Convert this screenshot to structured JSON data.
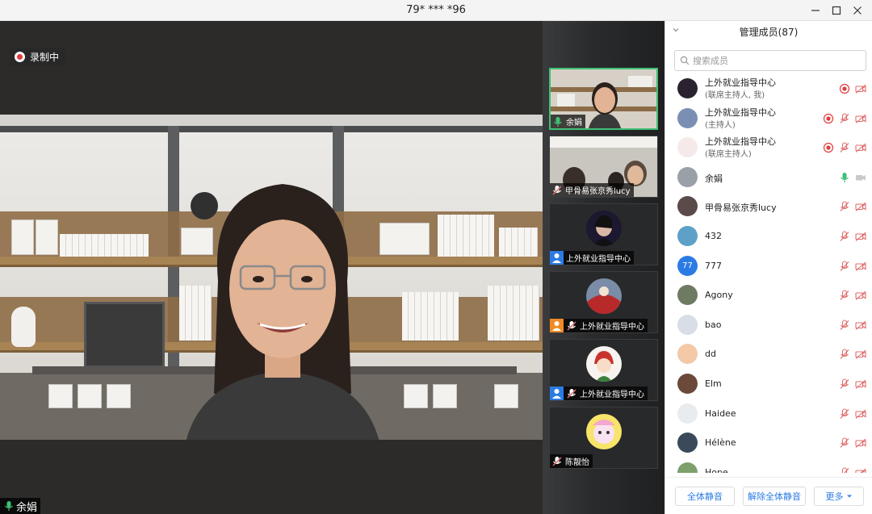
{
  "window": {
    "title": "79* *** *96"
  },
  "main_video": {
    "recording_label": "录制中",
    "speaker_name": "余娟"
  },
  "thumbnails": [
    {
      "name": "余娟",
      "mic": "on"
    },
    {
      "name": "甲骨易张京秀lucy",
      "mic": "muted"
    },
    {
      "name": "上外就业指导中心",
      "mic": "none",
      "host_badge": true
    },
    {
      "name": "上外就业指导中心",
      "mic": "muted",
      "host_badge": true
    },
    {
      "name": "上外就业指导中心",
      "mic": "muted",
      "host_badge": true
    },
    {
      "name": "陈靓怡",
      "mic": "muted"
    }
  ],
  "panel": {
    "title": "管理成员(87)",
    "search_placeholder": "搜索成员",
    "members": [
      {
        "name": "上外就业指导中心",
        "role": "(联席主持人, 我)",
        "recording": true,
        "mic": "none",
        "video": "off"
      },
      {
        "name": "上外就业指导中心",
        "role": "(主持人)",
        "recording": true,
        "mic": "muted",
        "video": "off"
      },
      {
        "name": "上外就业指导中心",
        "role": "(联席主持人)",
        "recording": true,
        "mic": "muted",
        "video": "off"
      },
      {
        "name": "余娟",
        "role": "",
        "recording": false,
        "mic": "on",
        "video": "off"
      },
      {
        "name": "甲骨易张京秀lucy",
        "role": "",
        "recording": false,
        "mic": "muted",
        "video": "off"
      },
      {
        "name": "432",
        "role": "",
        "recording": false,
        "mic": "muted",
        "video": "off"
      },
      {
        "name": "777",
        "role": "",
        "recording": false,
        "mic": "muted",
        "video": "off",
        "initials": "77"
      },
      {
        "name": "Agony",
        "role": "",
        "recording": false,
        "mic": "muted",
        "video": "off"
      },
      {
        "name": "bao",
        "role": "",
        "recording": false,
        "mic": "muted",
        "video": "off"
      },
      {
        "name": "dd",
        "role": "",
        "recording": false,
        "mic": "muted",
        "video": "off"
      },
      {
        "name": "Elm",
        "role": "",
        "recording": false,
        "mic": "muted",
        "video": "off"
      },
      {
        "name": "Haidee",
        "role": "",
        "recording": false,
        "mic": "muted",
        "video": "off"
      },
      {
        "name": "Hélène",
        "role": "",
        "recording": false,
        "mic": "muted",
        "video": "off"
      },
      {
        "name": "Hope",
        "role": "",
        "recording": false,
        "mic": "muted",
        "video": "off"
      }
    ],
    "footer": {
      "mute_all": "全体静音",
      "unmute_all": "解除全体静音",
      "more": "更多"
    }
  },
  "colors": {
    "accent": "#2b7be5",
    "recording_red": "#e23b3b",
    "mic_green": "#3fc074",
    "muted_red": "#e06b6b"
  }
}
